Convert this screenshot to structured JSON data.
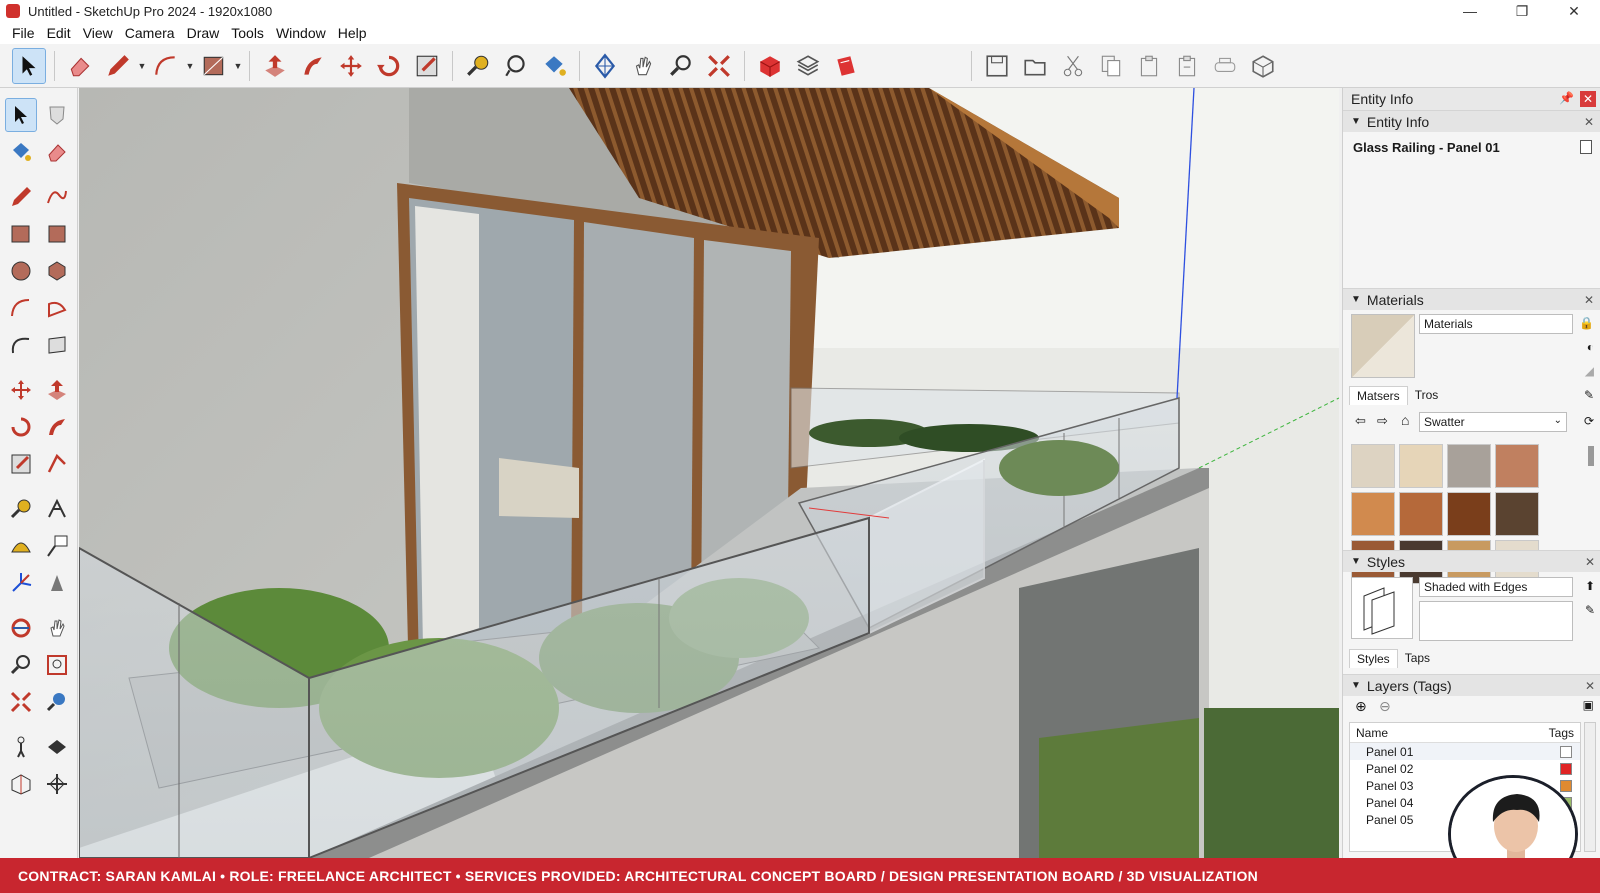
{
  "window": {
    "title": "Untitled - SketchUp Pro 2024 - 1920x1080",
    "controls": [
      "—",
      "❐",
      "✕"
    ]
  },
  "menu": [
    "File",
    "Edit",
    "View",
    "Camera",
    "Draw",
    "Tools",
    "Window",
    "Help"
  ],
  "toolbar": {
    "tools": [
      "select-tool",
      "eraser-tool",
      "line-tool",
      "arc-tool",
      "rectangle-tool",
      "push-pull-tool",
      "follow-me-tool",
      "move-tool",
      "rotate-tool",
      "scale-tool",
      "tape-measure-tool",
      "dimension-tool",
      "paint-bucket-tool",
      "orbit-tool",
      "pan-tool",
      "zoom-tool",
      "zoom-extents-tool",
      "3d-warehouse",
      "extension-warehouse",
      "layout-send",
      "save",
      "open",
      "cut",
      "copy",
      "paste",
      "paste-in-place",
      "print",
      "model-info"
    ]
  },
  "entity_info": {
    "tray_title": "Entity Info",
    "section": "Entity Info",
    "name": "Glass Railing - Panel 01"
  },
  "materials": {
    "section": "Materials",
    "name_field": "Materials",
    "tabs": [
      "Matsers",
      "Tros"
    ],
    "library": "Swatter",
    "swatches": [
      "#ddd3c2",
      "#e6d5b8",
      "#a8a19a",
      "#c08060",
      "#d18a4e",
      "#b5693a",
      "#7a3e1b",
      "#5a4330",
      "#9a5a35",
      "#4a3a30",
      "#c89a60",
      "#e4dccd"
    ]
  },
  "styles": {
    "section": "Styles",
    "name_field": "Shaded with Edges",
    "tabs": [
      "Styles",
      "Taps"
    ]
  },
  "layers": {
    "section": "Layers (Tags)",
    "col_name": "Name",
    "col_tags": "Tags",
    "rows": [
      {
        "name": "Panel 01",
        "color": "#ffffff"
      },
      {
        "name": "Panel 02",
        "color": "#e02424"
      },
      {
        "name": "Panel 03",
        "color": "#e08a30"
      },
      {
        "name": "Panel 04",
        "color": "#9bbd6a"
      },
      {
        "name": "Panel 05",
        "color": "#6a8fd0"
      }
    ]
  },
  "banner": {
    "text": "CONTRACT: SARAN KAMLAI  • ROLE: FREELANCE ARCHITECT  • SERVICES PROVIDED: ARCHITECTURAL CONCEPT BOARD / DESIGN PRESENTATION BOARD / 3D VISUALIZATION"
  },
  "colors": {
    "accent": "#c8262f",
    "select_blue": "#cde3f7"
  }
}
